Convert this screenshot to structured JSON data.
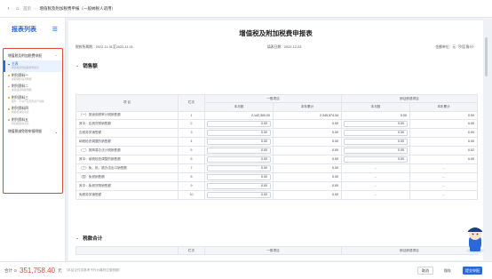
{
  "topbar": {
    "crumbs": [
      "首页",
      "增值税及附加税费申报（一般纳税人适用）"
    ]
  },
  "sidebar": {
    "title": "报表列表",
    "group_label": "增值税及附加税费申报",
    "items": [
      {
        "title": "主表",
        "sub": "增值税及附加税费申报表"
      },
      {
        "title": "附列资料一",
        "sub": "本期销售情况明细"
      },
      {
        "title": "附列资料二",
        "sub": "本期进项税额明细"
      },
      {
        "title": "附列资料三",
        "sub": "服务、不动产和无形资产扣除"
      },
      {
        "title": "附列资料四",
        "sub": "税额抵减情况表"
      },
      {
        "title": "附列资料五",
        "sub": "附加税费情况表"
      }
    ],
    "footer_label": "增值税减免税申报明细"
  },
  "main": {
    "title": "增值税及附加税费申报表",
    "period": "税款所属期：2022-11-01至2022-11-01",
    "fill_date": "填表日期：2022-12-03",
    "amount_unit": "金额单位：元（列至角分）",
    "section1": "销售额",
    "section2": "税款合计",
    "headers": {
      "item": "项 目",
      "col": "栏次",
      "general": "一般项目",
      "immediate": "即征即退项目",
      "this_month": "本月数",
      "this_year": "本年累计"
    },
    "rows": [
      {
        "name": "（一）按适用税率计税销售额",
        "col": "1",
        "v1": "2,142,300.00",
        "v2": "2,345,574.34",
        "v3": "0.00",
        "v4": "0.00",
        "editable": false
      },
      {
        "name": "其中：应税货物销售额",
        "col": "2",
        "v1": "0.00",
        "v2": "0.00",
        "v3": "0.00",
        "v4": "0.00",
        "editable": true
      },
      {
        "name": "应税劳务销售额",
        "col": "3",
        "v1": "0.00",
        "v2": "0.00",
        "v3": "0.00",
        "v4": "0.00",
        "editable": true
      },
      {
        "name": "纳税检查调整的销售额",
        "col": "4",
        "v1": "0.00",
        "v2": "0.00",
        "v3": "0.00",
        "v4": "0.00",
        "editable": true
      },
      {
        "name": "（二）按简易办法计税销售额",
        "col": "5",
        "v1": "0.00",
        "v2": "0.00",
        "v3": "0.00",
        "v4": "0.02",
        "editable": true
      },
      {
        "name": "其中：纳税检查调整的销售额",
        "col": "6",
        "v1": "0.00",
        "v2": "0.00",
        "v3": "0.00",
        "v4": "0.00",
        "editable": true
      },
      {
        "name": "（三）免、抵、退办法出口销售额",
        "col": "7",
        "v1": "0.00",
        "v2": "0.00",
        "v3": "--",
        "v4": "--",
        "editable": true
      },
      {
        "name": "（四）免税销售额",
        "col": "8",
        "v1": "0.00",
        "v2": "0.00",
        "v3": "--",
        "v4": "--",
        "editable": true
      },
      {
        "name": "其中：免税货物销售额",
        "col": "9",
        "v1": "0.00",
        "v2": "0.00",
        "v3": "--",
        "v4": "--",
        "editable": true
      },
      {
        "name": "免税劳务销售额",
        "col": "10",
        "v1": "0.00",
        "v2": "0.00",
        "v3": "--",
        "v4": "--",
        "editable": true
      }
    ]
  },
  "footer": {
    "total_label": "合计 ⊙",
    "total_amount": "351,758.40",
    "unit": "元",
    "note": "（本结论仅供参考不作为最终应缴税额）",
    "cancel": "取消",
    "ghost": "保存",
    "submit": "提交申报"
  },
  "colors": {
    "accent": "#2a6ad8",
    "highlight_border": "#e0463a",
    "amount": "#e0463a"
  }
}
